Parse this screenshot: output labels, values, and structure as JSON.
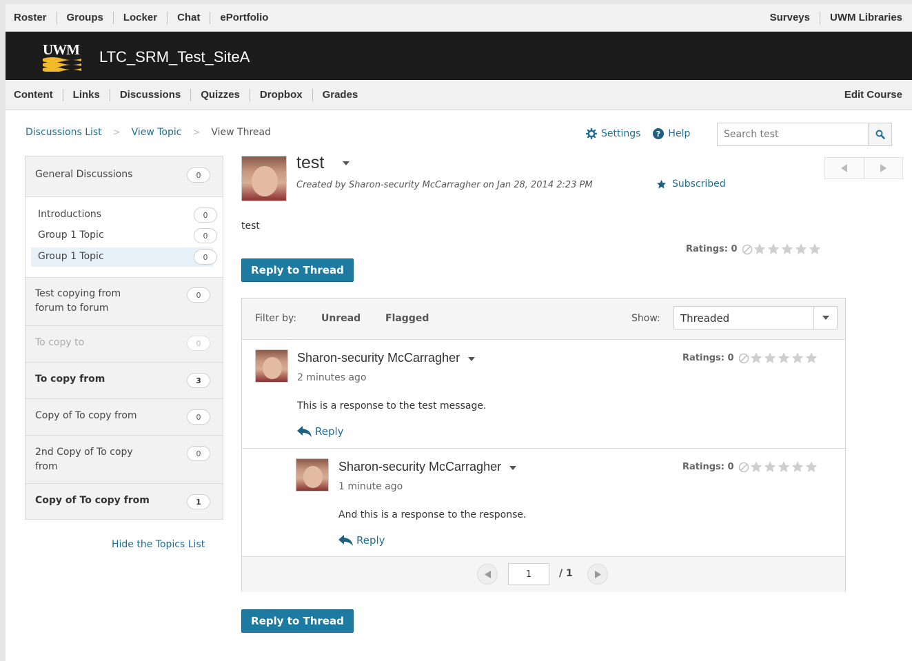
{
  "top_nav": {
    "left": [
      "Roster",
      "Groups",
      "Locker",
      "Chat",
      "ePortfolio"
    ],
    "right": [
      "Surveys",
      "UWM Libraries"
    ]
  },
  "banner": {
    "logo_text": "UWM",
    "site_title": "LTC_SRM_Test_SiteA"
  },
  "course_nav": {
    "left": [
      "Content",
      "Links",
      "Discussions",
      "Quizzes",
      "Dropbox",
      "Grades"
    ],
    "right": [
      "Edit Course"
    ]
  },
  "breadcrumb": {
    "link1": "Discussions List",
    "link2": "View Topic",
    "current": "View Thread"
  },
  "tools": {
    "settings": "Settings",
    "help": "Help",
    "search_placeholder": "Search test"
  },
  "sidebar": {
    "forum1": {
      "label": "General Discussions",
      "count": "0"
    },
    "topics": [
      {
        "label": "Introductions",
        "count": "0"
      },
      {
        "label": "Group 1 Topic",
        "count": "0"
      },
      {
        "label": "Group 1 Topic",
        "count": "0"
      }
    ],
    "forum2": {
      "line1": "Test copying from",
      "line2": "forum to forum",
      "count": "0"
    },
    "forum3": {
      "label": "To copy to",
      "count": "0"
    },
    "forum4": {
      "label": "To copy from",
      "count": "3"
    },
    "forum5": {
      "label": "Copy of To copy from",
      "count": "0"
    },
    "forum6": {
      "line1": "2nd Copy of To copy",
      "line2": "from",
      "count": "0"
    },
    "forum7": {
      "label": "Copy of To copy from",
      "count": "1"
    },
    "hide_link": "Hide the Topics List"
  },
  "thread": {
    "title": "test",
    "meta": "Created by Sharon-security McCarragher on Jan 28, 2014 2:23 PM",
    "subscribed": "Subscribed",
    "body": "test",
    "ratings_label": "Ratings: 0",
    "rating_value": 0
  },
  "reply_button": "Reply to Thread",
  "filter": {
    "label": "Filter by:",
    "unread": "Unread",
    "flagged": "Flagged",
    "show_label": "Show:",
    "show_value": "Threaded"
  },
  "posts": [
    {
      "author": "Sharon-security McCarragher",
      "time": "2 minutes ago",
      "text": "This is a response to the test message.",
      "ratings_label": "Ratings: 0",
      "reply": "Reply"
    },
    {
      "author": "Sharon-security McCarragher",
      "time": "1 minute ago",
      "text": "And this is a response to the response.",
      "ratings_label": "Ratings: 0",
      "reply": "Reply"
    }
  ],
  "paging": {
    "current_page": "1",
    "total": "/ 1"
  },
  "colors": {
    "link": "#1f6e93",
    "button": "#1d7aa1",
    "banner": "#1c1c1c",
    "logo_gold": "#f2b928"
  },
  "icons": [
    "gear-icon",
    "help-icon",
    "search-icon",
    "star-icon",
    "reply-icon",
    "chevron-left-icon",
    "chevron-right-icon",
    "chevron-down-icon",
    "no-rating-icon"
  ]
}
